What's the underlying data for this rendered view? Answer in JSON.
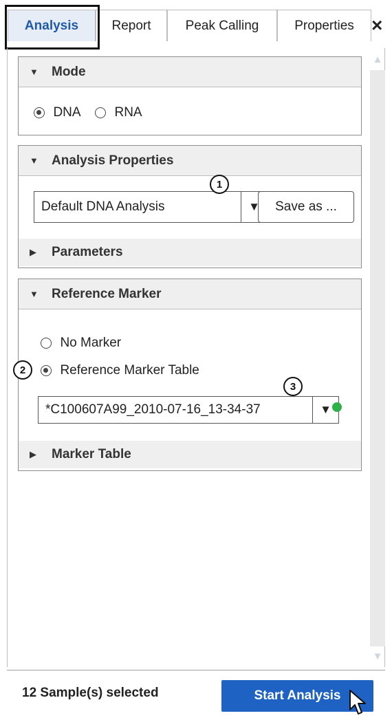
{
  "tabs": [
    {
      "label": "Analysis",
      "active": true
    },
    {
      "label": "Report",
      "active": false
    },
    {
      "label": "Peak Calling",
      "active": false
    },
    {
      "label": "Properties",
      "active": false
    }
  ],
  "close_icon": "×",
  "mode": {
    "title": "Mode",
    "options": [
      {
        "label": "DNA",
        "selected": true
      },
      {
        "label": "RNA",
        "selected": false
      }
    ]
  },
  "analysis_properties": {
    "title": "Analysis Properties",
    "dropdown_value": "Default DNA Analysis",
    "save_as_label": "Save as ...",
    "parameters_label": "Parameters"
  },
  "reference_marker": {
    "title": "Reference Marker",
    "options": [
      {
        "label": "No Marker",
        "selected": false
      },
      {
        "label": "Reference Marker Table",
        "selected": true
      }
    ],
    "dropdown_value": "*C100607A99_2010-07-16_13-34-37",
    "marker_table_label": "Marker Table",
    "status_color": "#2fb14a"
  },
  "callouts": [
    "1",
    "2",
    "3"
  ],
  "footer": {
    "status": "12 Sample(s) selected",
    "start_label": "Start Analysis"
  },
  "colors": {
    "accent": "#1e63c4",
    "active_tab_bg": "#e6edf7",
    "active_tab_text": "#1f5aa6"
  }
}
